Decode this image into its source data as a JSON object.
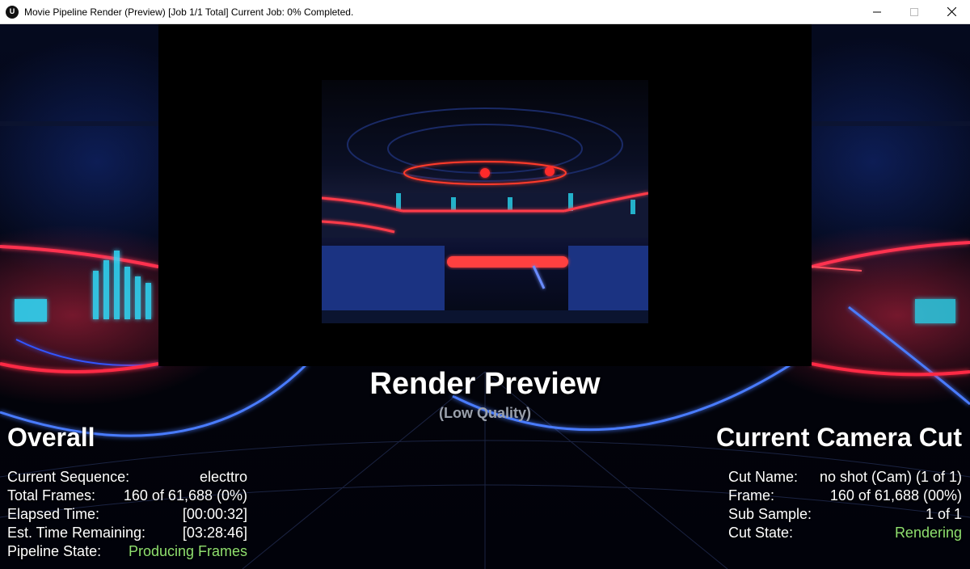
{
  "window": {
    "title": "Movie Pipeline Render (Preview) [Job 1/1 Total] Current Job: 0% Completed.",
    "app_icon_glyph": "U",
    "controls": [
      "minimize-icon",
      "maximize-icon",
      "close-icon"
    ]
  },
  "preview": {
    "title": "Render Preview",
    "subtitle": "(Low Quality)"
  },
  "overall": {
    "heading": "Overall",
    "rows": [
      {
        "label": "Current Sequence:",
        "value": "electtro"
      },
      {
        "label": "Total Frames:",
        "value": "160 of 61,688 (0%)"
      },
      {
        "label": "Elapsed Time:",
        "value": "[00:00:32]"
      },
      {
        "label": "Est. Time Remaining:",
        "value": "[03:28:46]"
      },
      {
        "label": "Pipeline State:",
        "value": "Producing Frames"
      }
    ]
  },
  "camera_cut": {
    "heading": "Current Camera Cut",
    "rows": [
      {
        "label": "Cut Name:",
        "value": "no shot (Cam) (1 of 1)"
      },
      {
        "label": "Frame:",
        "value": "160 of 61,688 (00%)"
      },
      {
        "label": "Sub Sample:",
        "value": "1 of 1"
      },
      {
        "label": "Cut State:",
        "value": "Rendering"
      }
    ]
  },
  "colors": {
    "accent_green": "#8fe06f",
    "neon_blue": "#3a6cff",
    "neon_red": "#ff2f4a"
  }
}
